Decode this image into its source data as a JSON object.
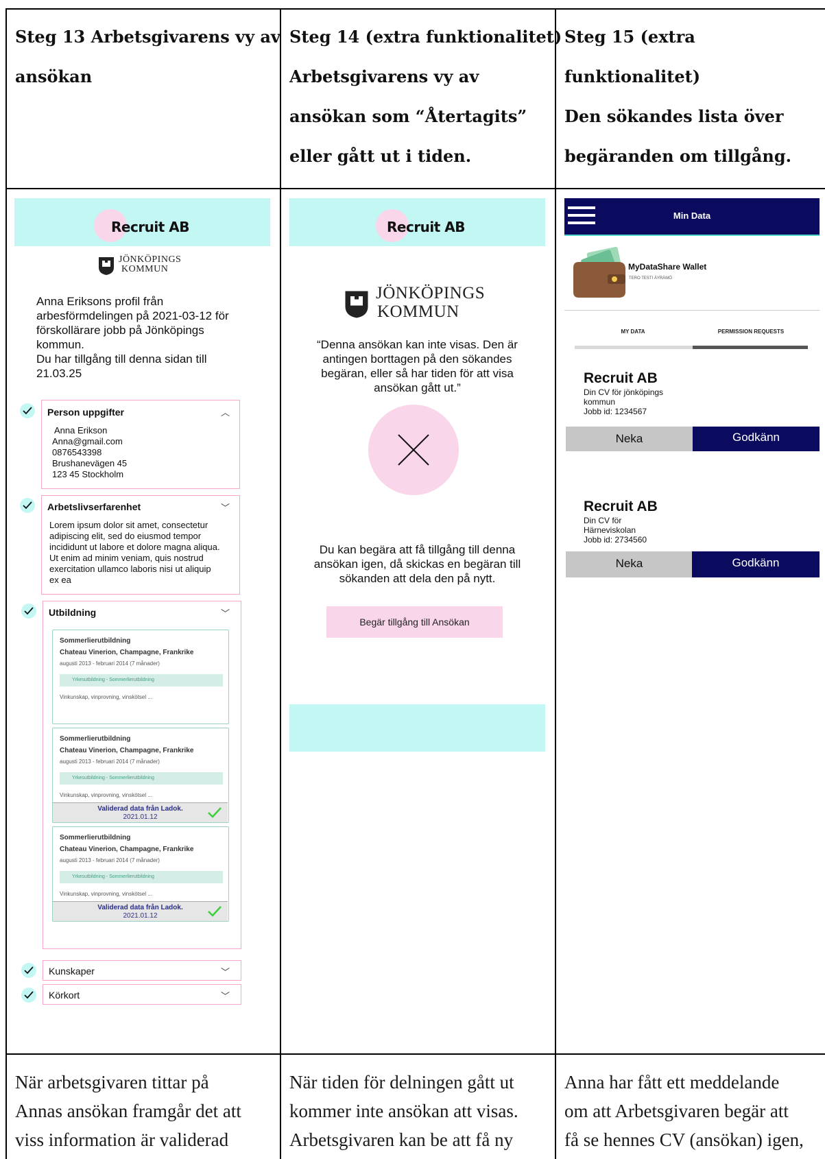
{
  "headers": {
    "col1": [
      "Steg 13 Arbetsgivarens vy av",
      "ansökan"
    ],
    "col2": [
      "Steg 14 (extra funktionalitet)",
      "Arbetsgivarens vy av",
      "ansökan som “Återtagits”",
      "eller gått ut i tiden."
    ],
    "col3": [
      "Steg 15 (extra funktionalitet)",
      "Den sökandes lista över",
      "begäranden om tillgång."
    ]
  },
  "brand": {
    "recruit_logo": "Recruit AB",
    "kommun_line1": "JÖNKÖPINGS",
    "kommun_line2": "KOMMUN"
  },
  "col1": {
    "intro": [
      " Anna Eriksons profil från",
      "arbesförmdelingen på 2021-03-12 för",
      "förskollärare jobb på Jönköpings",
      "kommun.",
      "Du har tillgång till denna sidan till",
      "21.03.25"
    ],
    "person": {
      "title": "Person uppgifter",
      "lines": [
        "Anna Erikson",
        "Anna@gmail.com",
        "0876543398",
        "Brushanevägen 45",
        "123 45 Stockholm"
      ]
    },
    "experience": {
      "title": "Arbetslivserfarenhet",
      "lines": [
        "Lorem ipsum dolor sit amet, consectetur",
        "adipiscing elit, sed do eiusmod tempor",
        "incididunt ut labore et dolore magna aliqua.",
        "Ut enim ad minim veniam, quis nostrud",
        "exercitation ullamco laboris nisi ut aliquip",
        "ex ea"
      ]
    },
    "education": {
      "title": "Utbildning",
      "card_title": "Sommerlierutbildning",
      "card_place": "Chateau Vinerion, Champagne, Frankrike",
      "card_dates": "augusti 2013 - februari 2014 (7 månader)",
      "card_tag": "Yrkesutbildning - Sommerlierutbildning",
      "card_skills": "Vinkunskap, vinprovning, vinskötsel ...",
      "validated_label": "Validerad data från Ladok.",
      "validated_date": "2021.01.12"
    },
    "skills": {
      "title": "Kunskaper"
    },
    "license": {
      "title": "Körkort"
    }
  },
  "col2": {
    "message": [
      "“Denna ansökan kan inte visas. Den är",
      "antingen borttagen på den sökandes",
      "begäran, eller så har tiden för att visa",
      "ansökan gått ut.”"
    ],
    "request_info": [
      "Du kan begära att få tillgång till denna",
      "ansökan igen, då skickas en begäran till",
      "sökanden att dela den på nytt."
    ],
    "request_button": "Begär tillgång till Ansökan"
  },
  "col3": {
    "app_title": "Min Data",
    "wallet_name": "MyDataShare Wallet",
    "wallet_user": "TERO TESTI ÄYRÄMÖ",
    "tabs": [
      "MY DATA",
      "PERMISSION REQUESTS"
    ],
    "requests": [
      {
        "company": "Recruit AB",
        "lines": [
          "Din CV för jönköpings",
          "kommun",
          "Jobb id: 1234567"
        ],
        "deny": "Neka",
        "approve": "Godkänn"
      },
      {
        "company": "Recruit AB",
        "lines": [
          "Din CV för",
          "Härneviskolan",
          "Jobb id: 2734560"
        ],
        "deny": "Neka",
        "approve": "Godkänn"
      }
    ]
  },
  "footers": {
    "col1": [
      "När arbetsgivaren tittar på",
      "Annas ansökan framgår det att",
      "viss information är validerad"
    ],
    "col2": [
      "När tiden för delningen gått ut",
      "kommer inte ansökan att visas.",
      "Arbetsgivaren kan be att få ny"
    ],
    "col3": [
      "Anna har fått ett meddelande",
      "om att Arbetsgivaren begär att",
      "få se hennes CV (ansökan) igen,"
    ]
  },
  "colors": {
    "cyan": "#c3f7f4",
    "pink": "#f9d6ea",
    "navy": "#0a0a5e",
    "accordion_border": "#f4a7c9",
    "check_green": "#3ccf3c"
  }
}
